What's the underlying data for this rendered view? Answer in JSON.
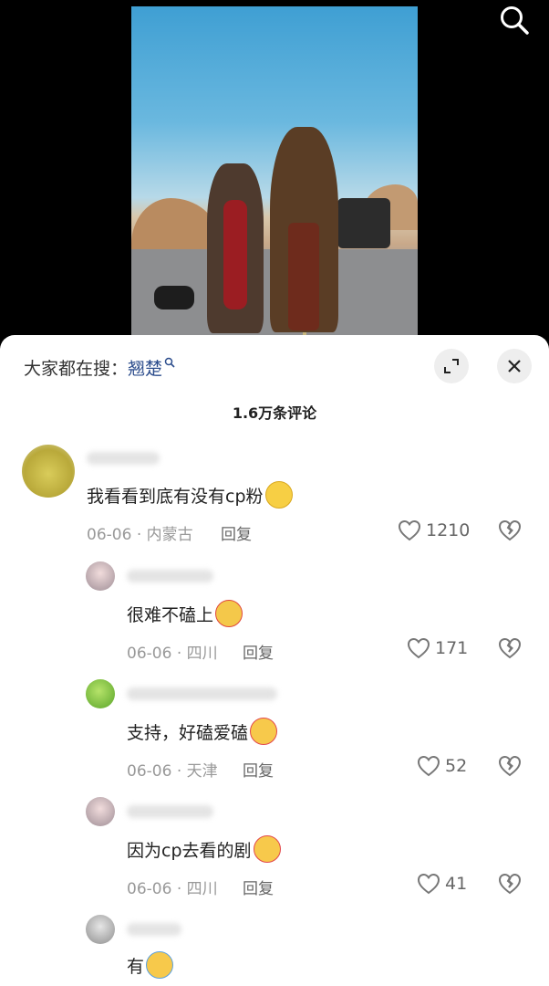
{
  "hot_search": {
    "prefix": "大家都在搜：",
    "keyword": "翘楚"
  },
  "comments_count": "1.6万条评论",
  "comments": [
    {
      "text": "我看看到底有没有cp粉",
      "date": "06-06",
      "location": "内蒙古",
      "reply_label": "回复",
      "likes": "1210"
    },
    {
      "text": "很难不磕上",
      "date": "06-06",
      "location": "四川",
      "reply_label": "回复",
      "likes": "171"
    },
    {
      "text": "支持，好磕爱磕",
      "date": "06-06",
      "location": "天津",
      "reply_label": "回复",
      "likes": "52"
    },
    {
      "text": "因为cp去看的剧",
      "date": "06-06",
      "location": "四川",
      "reply_label": "回复",
      "likes": "41"
    },
    {
      "text": "有"
    }
  ],
  "separator": "·",
  "icons": {
    "search": "search-icon",
    "expand": "expand-icon",
    "close": "close-icon",
    "like": "heart-outline-icon",
    "dislike": "broken-heart-icon"
  }
}
